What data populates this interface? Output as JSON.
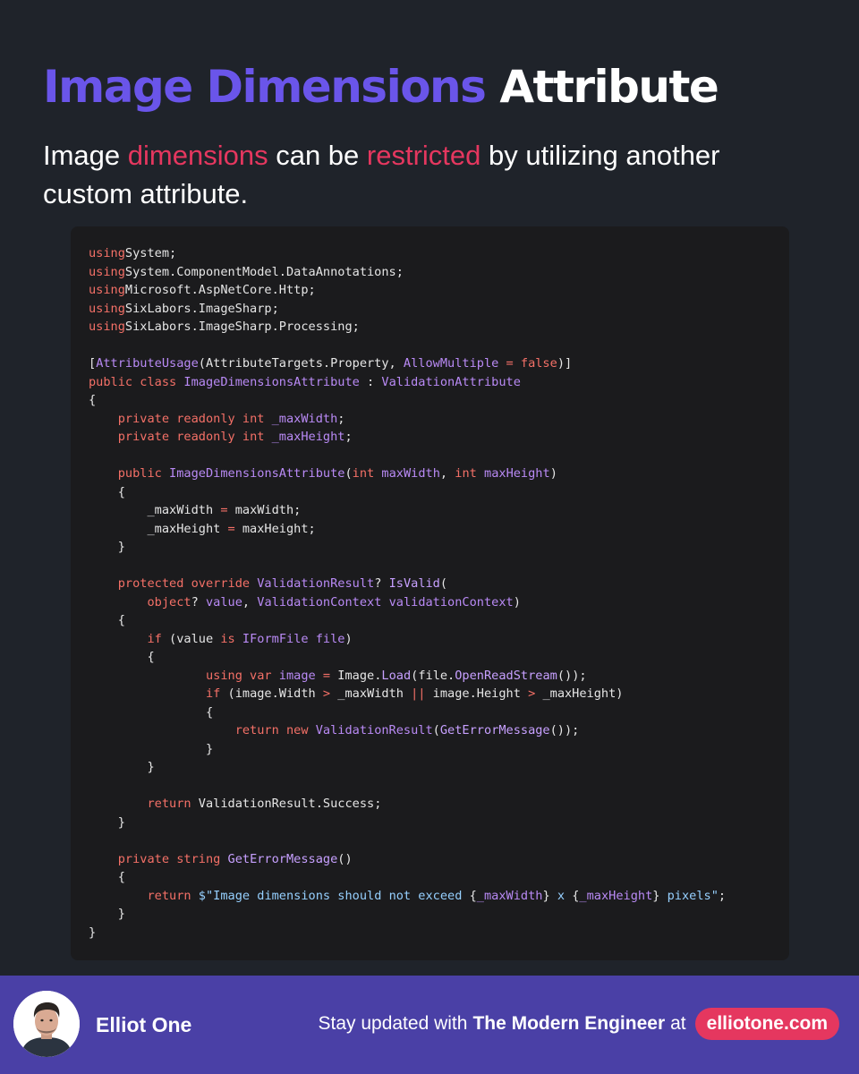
{
  "header": {
    "title_accent": "Image Dimensions",
    "title_rest": "Attribute"
  },
  "subtitle": {
    "part1": "Image ",
    "hl1": "dimensions",
    "part2": " can be ",
    "hl2": "restricted",
    "part3": " by utilizing another custom attribute."
  },
  "code": {
    "language": "csharp",
    "lines": [
      [
        [
          "kw",
          "using"
        ],
        [
          "",
          "System"
        ],
        [
          "",
          ";"
        ]
      ],
      [
        [
          "kw",
          "using"
        ],
        [
          "",
          "System.ComponentModel.DataAnnotations"
        ],
        [
          "",
          ";"
        ]
      ],
      [
        [
          "kw",
          "using"
        ],
        [
          "",
          "Microsoft.AspNetCore.Http"
        ],
        [
          "",
          ";"
        ]
      ],
      [
        [
          "kw",
          "using"
        ],
        [
          "",
          "SixLabors.ImageSharp"
        ],
        [
          "",
          ";"
        ]
      ],
      [
        [
          "kw",
          "using"
        ],
        [
          "",
          "SixLabors.ImageSharp.Processing"
        ],
        [
          "",
          ";"
        ]
      ],
      [],
      [
        [
          "",
          "["
        ],
        [
          "ty",
          "AttributeUsage"
        ],
        [
          "",
          "(AttributeTargets.Property, "
        ],
        [
          "ty",
          "AllowMultiple"
        ],
        [
          "kw",
          " = false"
        ],
        [
          "",
          ")]"
        ]
      ],
      [
        [
          "kw",
          "public class "
        ],
        [
          "ty",
          "ImageDimensionsAttribute"
        ],
        [
          "",
          " : "
        ],
        [
          "ty",
          "ValidationAttribute"
        ]
      ],
      [
        [
          "",
          "{"
        ]
      ],
      [
        [
          "",
          "    "
        ],
        [
          "kw",
          "private readonly int "
        ],
        [
          "ty",
          "_maxWidth"
        ],
        [
          "",
          ";"
        ]
      ],
      [
        [
          "",
          "    "
        ],
        [
          "kw",
          "private readonly int "
        ],
        [
          "ty",
          "_maxHeight"
        ],
        [
          "",
          ";"
        ]
      ],
      [],
      [
        [
          "",
          "    "
        ],
        [
          "kw",
          "public "
        ],
        [
          "ty",
          "ImageDimensionsAttribute"
        ],
        [
          "",
          "("
        ],
        [
          "kw",
          "int "
        ],
        [
          "ty",
          "maxWidth"
        ],
        [
          "",
          ", "
        ],
        [
          "kw",
          "int "
        ],
        [
          "ty",
          "maxHeight"
        ],
        [
          "",
          ")"
        ]
      ],
      [
        [
          "",
          "    {"
        ]
      ],
      [
        [
          "",
          "        _maxWidth "
        ],
        [
          "kw",
          "="
        ],
        [
          "",
          " maxWidth;"
        ]
      ],
      [
        [
          "",
          "        _maxHeight "
        ],
        [
          "kw",
          "="
        ],
        [
          "",
          " maxHeight;"
        ]
      ],
      [
        [
          "",
          "    }"
        ]
      ],
      [],
      [
        [
          "",
          "    "
        ],
        [
          "kw",
          "protected override "
        ],
        [
          "ty",
          "ValidationResult"
        ],
        [
          "",
          "? "
        ],
        [
          "fn",
          "IsValid"
        ],
        [
          "",
          "("
        ]
      ],
      [
        [
          "",
          "        "
        ],
        [
          "kw",
          "object"
        ],
        [
          "",
          "? "
        ],
        [
          "ty",
          "value"
        ],
        [
          "",
          ", "
        ],
        [
          "ty",
          "ValidationContext validationContext"
        ],
        [
          "",
          ")"
        ]
      ],
      [
        [
          "",
          "    {"
        ]
      ],
      [
        [
          "",
          "        "
        ],
        [
          "kw",
          "if"
        ],
        [
          "",
          " (value "
        ],
        [
          "kw",
          "is "
        ],
        [
          "ty",
          "IFormFile file"
        ],
        [
          "",
          ")"
        ]
      ],
      [
        [
          "",
          "        {"
        ]
      ],
      [
        [
          "",
          "                "
        ],
        [
          "kw",
          "using var "
        ],
        [
          "ty",
          "image"
        ],
        [
          "kw",
          " ="
        ],
        [
          "",
          " Image."
        ],
        [
          "fn",
          "Load"
        ],
        [
          "",
          "(file."
        ],
        [
          "fn",
          "OpenReadStream"
        ],
        [
          "",
          "());"
        ]
      ],
      [
        [
          "",
          "                "
        ],
        [
          "kw",
          "if"
        ],
        [
          "",
          " (image.Width "
        ],
        [
          "kw",
          ">"
        ],
        [
          "",
          " _maxWidth "
        ],
        [
          "kw",
          "||"
        ],
        [
          "",
          " image.Height "
        ],
        [
          "kw",
          ">"
        ],
        [
          "",
          " _maxHeight)"
        ]
      ],
      [
        [
          "",
          "                {"
        ]
      ],
      [
        [
          "",
          "                    "
        ],
        [
          "kw",
          "return new "
        ],
        [
          "ty",
          "ValidationResult"
        ],
        [
          "",
          "("
        ],
        [
          "fn",
          "GetErrorMessage"
        ],
        [
          "",
          "());"
        ]
      ],
      [
        [
          "",
          "                }"
        ]
      ],
      [
        [
          "",
          "        }"
        ]
      ],
      [],
      [
        [
          "",
          "        "
        ],
        [
          "kw",
          "return "
        ],
        [
          "",
          "ValidationResult.Success;"
        ]
      ],
      [
        [
          "",
          "    }"
        ]
      ],
      [],
      [
        [
          "",
          "    "
        ],
        [
          "kw",
          "private string "
        ],
        [
          "fn",
          "GetErrorMessage"
        ],
        [
          "",
          "()"
        ]
      ],
      [
        [
          "",
          "    {"
        ]
      ],
      [
        [
          "",
          "        "
        ],
        [
          "kw",
          "return "
        ],
        [
          "str",
          "$\"Image dimensions should not exceed "
        ],
        [
          "",
          "{"
        ],
        [
          "ty",
          "_maxWidth"
        ],
        [
          "",
          "}"
        ],
        [
          "str",
          " x "
        ],
        [
          "",
          "{"
        ],
        [
          "ty",
          "_maxHeight"
        ],
        [
          "",
          "}"
        ],
        [
          "str",
          " pixels\""
        ],
        [
          "",
          ";"
        ]
      ],
      [
        [
          "",
          "    }"
        ]
      ],
      [
        [
          "",
          "}"
        ]
      ]
    ]
  },
  "footer": {
    "author": "Elliot One",
    "cta_prefix": "Stay updated with",
    "cta_brand": "The Modern Engineer",
    "cta_suffix": "at",
    "site": "elliotone.com"
  },
  "colors": {
    "background": "#1f232a",
    "accent_purple": "#6a55ea",
    "accent_pink": "#e5375f",
    "footer_bg": "#4a40a6",
    "code_bg": "#1b1b1d"
  }
}
